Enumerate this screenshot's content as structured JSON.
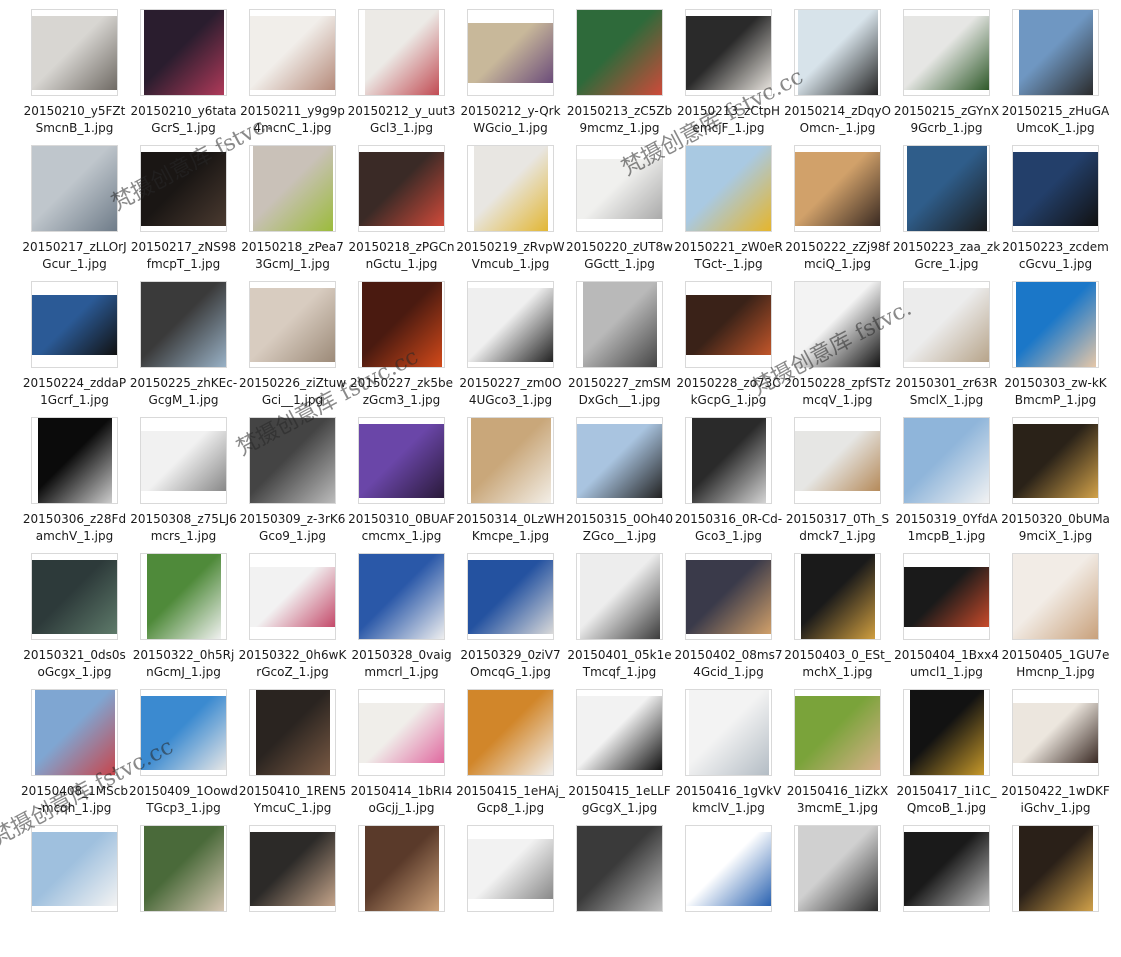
{
  "window": {
    "title": ""
  },
  "files": [
    {
      "name": "20150210_y5FZtSmcnB_1.jpg",
      "colors": [
        "#d8d6d2",
        "#6f6a64"
      ]
    },
    {
      "name": "20150210_y6tataGcrS_1.jpg",
      "colors": [
        "#2a1d2e",
        "#b13a5a"
      ]
    },
    {
      "name": "20150211_y9g9p4mcnC_1.jpg",
      "colors": [
        "#f1eeea",
        "#b58a7a"
      ]
    },
    {
      "name": "20150212_y_uut3Gcl3_1.jpg",
      "colors": [
        "#eceae6",
        "#c14a52"
      ]
    },
    {
      "name": "20150212_y-QrkWGcio_1.jpg",
      "colors": [
        "#c8b89a",
        "#6b4c7a"
      ]
    },
    {
      "name": "20150213_zC5Zb9mcmz_1.jpg",
      "colors": [
        "#2e6a3a",
        "#d04a3a"
      ]
    },
    {
      "name": "20150213_zCtpHemcjF_1.jpg",
      "colors": [
        "#2a2a2a",
        "#e6e2dc"
      ]
    },
    {
      "name": "20150214_zDqyOOmcn-_1.jpg",
      "colors": [
        "#d7e3ea",
        "#222222"
      ]
    },
    {
      "name": "20150215_zGYnX9Gcrb_1.jpg",
      "colors": [
        "#e6e6e4",
        "#2f5a2a"
      ]
    },
    {
      "name": "20150215_zHuGAUmcoK_1.jpg",
      "colors": [
        "#6f97c2",
        "#2a2a2a"
      ]
    },
    {
      "name": "20150217_zLLOrJGcur_1.jpg",
      "colors": [
        "#bfc6cc",
        "#6e7b88"
      ]
    },
    {
      "name": "20150217_zNS98fmcpT_1.jpg",
      "colors": [
        "#1a1614",
        "#4a3a30"
      ]
    },
    {
      "name": "20150218_zPea73GcmJ_1.jpg",
      "colors": [
        "#c9c1b8",
        "#9bbb3a"
      ]
    },
    {
      "name": "20150218_zPGCnnGctu_1.jpg",
      "colors": [
        "#3a2a26",
        "#d04a3a"
      ]
    },
    {
      "name": "20150219_zRvpWVmcub_1.jpg",
      "colors": [
        "#e8e6e2",
        "#e2b632"
      ]
    },
    {
      "name": "20150220_zUT8wGGctt_1.jpg",
      "colors": [
        "#f0f0ee",
        "#aaaaaa"
      ]
    },
    {
      "name": "20150221_zW0eRTGct-_1.jpg",
      "colors": [
        "#a9c9e2",
        "#e6b52a"
      ]
    },
    {
      "name": "20150222_zZj98fmciQ_1.jpg",
      "colors": [
        "#d1a16a",
        "#3a2a22"
      ]
    },
    {
      "name": "20150223_zaa_zkGcre_1.jpg",
      "colors": [
        "#2f5d8a",
        "#1a1a1a"
      ]
    },
    {
      "name": "20150223_zcdemcGcvu_1.jpg",
      "colors": [
        "#233f6a",
        "#111111"
      ]
    },
    {
      "name": "20150224_zddaP1Gcrf_1.jpg",
      "colors": [
        "#2b5a96",
        "#111111"
      ]
    },
    {
      "name": "20150225_zhKEc-GcgM_1.jpg",
      "colors": [
        "#3a3a3a",
        "#9ab3c8"
      ]
    },
    {
      "name": "20150226_ziZtuwGci__1.jpg",
      "colors": [
        "#d8ccc0",
        "#9c8a78"
      ]
    },
    {
      "name": "20150227_zk5bezGcm3_1.jpg",
      "colors": [
        "#4a1a10",
        "#d44a1a"
      ]
    },
    {
      "name": "20150227_zm0O4UGco3_1.jpg",
      "colors": [
        "#efefef",
        "#222222"
      ]
    },
    {
      "name": "20150227_zmSMDxGch__1.jpg",
      "colors": [
        "#b9b9b9",
        "#444444"
      ]
    },
    {
      "name": "20150228_zo73CkGcpG_1.jpg",
      "colors": [
        "#3a2218",
        "#c2562a"
      ]
    },
    {
      "name": "20150228_zpfSTzmcqV_1.jpg",
      "colors": [
        "#f3f3f3",
        "#111111"
      ]
    },
    {
      "name": "20150301_zr63RSmclX_1.jpg",
      "colors": [
        "#ececec",
        "#b7a48a"
      ]
    },
    {
      "name": "20150303_zw-kKBmcmP_1.jpg",
      "colors": [
        "#1b77c8",
        "#e8c8a8"
      ]
    },
    {
      "name": "20150306_z28FdamchV_1.jpg",
      "colors": [
        "#0b0b0b",
        "#cfcfcf"
      ]
    },
    {
      "name": "20150308_z75LJ6mcrs_1.jpg",
      "colors": [
        "#f1f1f1",
        "#888888"
      ]
    },
    {
      "name": "20150309_z-3rK6Gco9_1.jpg",
      "colors": [
        "#444444",
        "#bdbdbd"
      ]
    },
    {
      "name": "20150310_0BUAFcmcmx_1.jpg",
      "colors": [
        "#6a46a8",
        "#2a1a3a"
      ]
    },
    {
      "name": "20150314_0LzWHKmcpe_1.jpg",
      "colors": [
        "#c9a77a",
        "#f3efe8"
      ]
    },
    {
      "name": "20150315_0Oh40ZGco__1.jpg",
      "colors": [
        "#a9c4e0",
        "#222222"
      ]
    },
    {
      "name": "20150316_0R-Cd-Gco3_1.jpg",
      "colors": [
        "#2a2a2a",
        "#d6d6d6"
      ]
    },
    {
      "name": "20150317_0Th_Sdmck7_1.jpg",
      "colors": [
        "#e6e6e4",
        "#b58a5a"
      ]
    },
    {
      "name": "20150319_0YfdA1mcpB_1.jpg",
      "colors": [
        "#8fb5da",
        "#f3f3f3"
      ]
    },
    {
      "name": "20150320_0bUMa9mciX_1.jpg",
      "colors": [
        "#2a2218",
        "#d2a24a"
      ]
    },
    {
      "name": "20150321_0ds0soGcgx_1.jpg",
      "colors": [
        "#2d3a3a",
        "#5e7a6a"
      ]
    },
    {
      "name": "20150322_0h5RjnGcmJ_1.jpg",
      "colors": [
        "#4f8a3a",
        "#f2f2f2"
      ]
    },
    {
      "name": "20150322_0h6wKrGcoZ_1.jpg",
      "colors": [
        "#f2f2f2",
        "#c44a6a"
      ]
    },
    {
      "name": "20150328_0vaigmmcrl_1.jpg",
      "colors": [
        "#2a58a8",
        "#f0f0f0"
      ]
    },
    {
      "name": "20150329_0ziV7OmcqG_1.jpg",
      "colors": [
        "#2452a0",
        "#d9d9d9"
      ]
    },
    {
      "name": "20150401_05k1eTmcqf_1.jpg",
      "colors": [
        "#ededed",
        "#3a3a3a"
      ]
    },
    {
      "name": "20150402_08ms74Gcid_1.jpg",
      "colors": [
        "#3a3a4a",
        "#d1a06a"
      ]
    },
    {
      "name": "20150403_0_ESt_mchX_1.jpg",
      "colors": [
        "#1a1a1a",
        "#d2a040"
      ]
    },
    {
      "name": "20150404_1Bxx4umcl1_1.jpg",
      "colors": [
        "#1a1a1a",
        "#c84a2a"
      ]
    },
    {
      "name": "20150405_1GU7eHmcnp_1.jpg",
      "colors": [
        "#f2ece6",
        "#c8a07a"
      ]
    },
    {
      "name": "20150408_1MScb-mcqh_1.jpg",
      "colors": [
        "#7fa6d2",
        "#c8444a"
      ]
    },
    {
      "name": "20150409_1OowdTGcp3_1.jpg",
      "colors": [
        "#3b8ad0",
        "#e6e6e6"
      ]
    },
    {
      "name": "20150410_1REN5YmcuC_1.jpg",
      "colors": [
        "#2a2420",
        "#7a5a44"
      ]
    },
    {
      "name": "20150414_1bRI4oGcjj_1.jpg",
      "colors": [
        "#f0eeea",
        "#e06aa0"
      ]
    },
    {
      "name": "20150415_1eHAj_Gcp8_1.jpg",
      "colors": [
        "#d1862a",
        "#f2f2f2"
      ]
    },
    {
      "name": "20150415_1eLLFgGcgX_1.jpg",
      "colors": [
        "#f2f2f2",
        "#111111"
      ]
    },
    {
      "name": "20150416_1gVkVkmclV_1.jpg",
      "colors": [
        "#f3f3f3",
        "#b3bcc4"
      ]
    },
    {
      "name": "20150416_1iZkX3mcmE_1.jpg",
      "colors": [
        "#7aa33a",
        "#d8b08a"
      ]
    },
    {
      "name": "20150417_1i1C_QmcoB_1.jpg",
      "colors": [
        "#121212",
        "#c89a2a"
      ]
    },
    {
      "name": "20150422_1wDKFiGchv_1.jpg",
      "colors": [
        "#ece6de",
        "#3a2a24"
      ]
    },
    {
      "name": "",
      "colors": [
        "#9fc0de",
        "#f3f3f3"
      ]
    },
    {
      "name": "",
      "colors": [
        "#4a6a3a",
        "#d7c7b4"
      ]
    },
    {
      "name": "",
      "colors": [
        "#2c2a28",
        "#c4a48a"
      ]
    },
    {
      "name": "",
      "colors": [
        "#5a3a2a",
        "#cda27a"
      ]
    },
    {
      "name": "",
      "colors": [
        "#f2f2f2",
        "#888888"
      ]
    },
    {
      "name": "",
      "colors": [
        "#3a3a3a",
        "#bfbfbf"
      ]
    },
    {
      "name": "",
      "colors": [
        "#ffffff",
        "#2a62b0"
      ]
    },
    {
      "name": "",
      "colors": [
        "#d0d0d0",
        "#2a2a2a"
      ]
    },
    {
      "name": "",
      "colors": [
        "#1a1a1a",
        "#bfbfbf"
      ]
    },
    {
      "name": "",
      "colors": [
        "#2a2018",
        "#d2a24a"
      ]
    }
  ],
  "watermarks": [
    "梵摄创意库 fstvc.",
    "梵摄创意库 fstvc.cc",
    "梵摄创意库 fstvc.cc",
    "梵摄创意库 fstvc.",
    "梵摄创意库 fstvc.cc"
  ]
}
